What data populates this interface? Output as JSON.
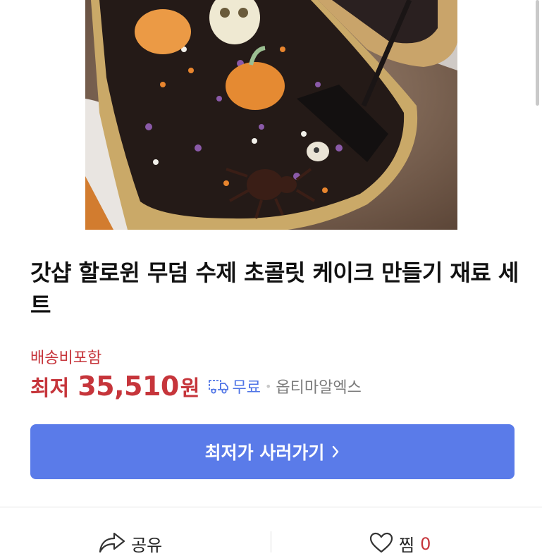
{
  "product": {
    "title": "갓샵 할로윈 무덤 수제 초콜릿 케이크 만들기 재료 세트",
    "shipping_note": "배송비포함",
    "price_prefix": "최저",
    "price": "35,510",
    "currency_unit": "원",
    "delivery_label": "무료",
    "separator": "•",
    "seller": "옵티마알엑스"
  },
  "actions": {
    "buy_label": "최저가 사러가기",
    "share_label": "공유",
    "like_label": "찜",
    "like_count": "0"
  },
  "icons": {
    "expand": "expand-arrows-icon",
    "delivery": "delivery-truck-icon",
    "chevron": "chevron-right-icon",
    "share": "share-arrow-icon",
    "like": "heart-icon"
  },
  "colors": {
    "accent_button": "#5a7be9",
    "price_red": "#c6353b",
    "delivery_blue": "#4f74e6",
    "seller_gray": "#7b7b7b"
  }
}
